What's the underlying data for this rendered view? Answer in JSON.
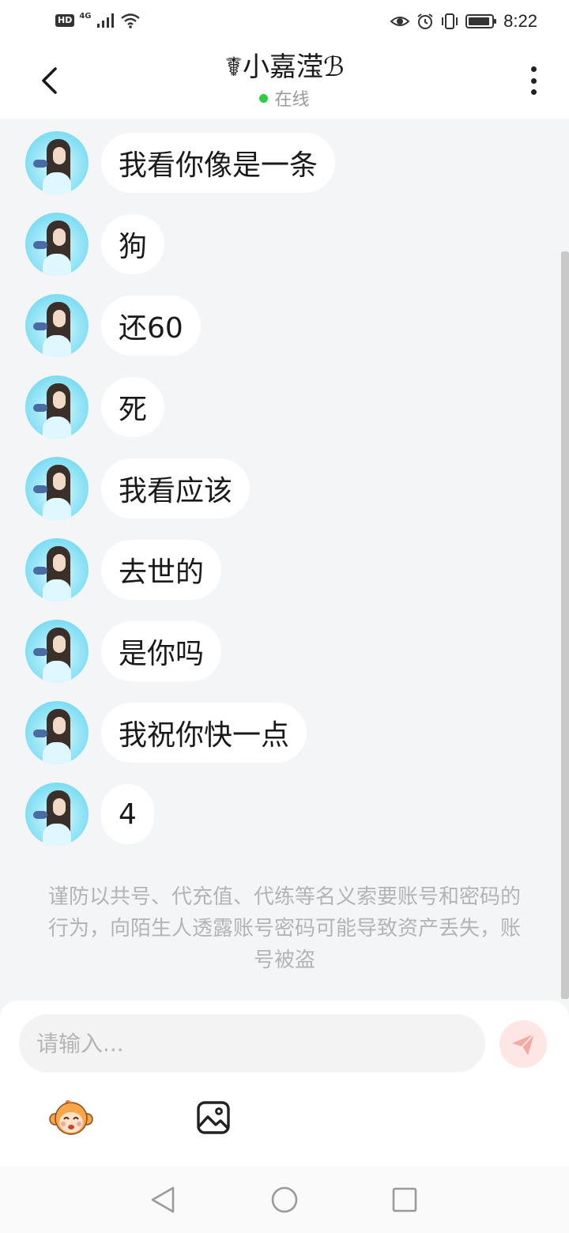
{
  "status_bar": {
    "left_badge": "HD",
    "network": "4G",
    "time": "8:22"
  },
  "header": {
    "title": "☤小嘉滢ℬ",
    "online_status": "在线"
  },
  "messages": [
    {
      "text": "我看你像是一条"
    },
    {
      "text": "狗"
    },
    {
      "text": "还60"
    },
    {
      "text": "死"
    },
    {
      "text": "我看应该"
    },
    {
      "text": "去世的"
    },
    {
      "text": "是你吗"
    },
    {
      "text": "我祝你快一点"
    },
    {
      "text": "4"
    }
  ],
  "notice": "谨防以共号、代充值、代练等名义索要账号和密码的行为，向陌生人透露账号密码可能导致资产丢失，账号被盗",
  "input": {
    "placeholder": "请输入..."
  },
  "colors": {
    "online": "#2ecc40",
    "send_button": "#fde6e4",
    "send_icon": "#f6a9a3",
    "bubble": "#ffffff",
    "chat_background": "#f4f5f7",
    "notice_text": "#b4b4b4"
  },
  "icons": {
    "back": "chevron-left-icon",
    "more": "more-vertical-icon",
    "send": "paper-plane-icon",
    "emoji": "monkey-emoji-icon",
    "image": "image-icon",
    "nav_back": "triangle-back-icon",
    "nav_home": "circle-home-icon",
    "nav_recents": "square-recents-icon"
  }
}
